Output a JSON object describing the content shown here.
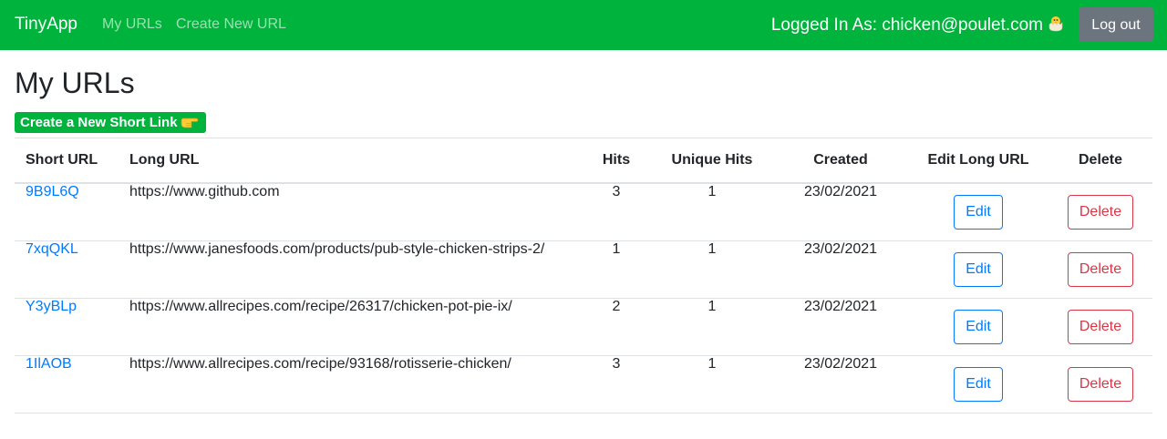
{
  "navbar": {
    "brand": "TinyApp",
    "links": [
      "My URLs",
      "Create New URL"
    ],
    "logged_in_text": "Logged In As: chicken@poulet.com",
    "logged_in_icon": "hatching-chick-icon",
    "logout_label": "Log out",
    "background_color": "#00b33c"
  },
  "page": {
    "title": "My URLs",
    "create_button_label": "Create a New Short Link",
    "create_button_icon": "pointing-hand-icon"
  },
  "table": {
    "headers": [
      "Short URL",
      "Long URL",
      "Hits",
      "Unique Hits",
      "Created",
      "Edit Long URL",
      "Delete"
    ],
    "rows": [
      {
        "short": "9B9L6Q",
        "long": "https://www.github.com",
        "hits": "3",
        "unique": "1",
        "created": "23/02/2021",
        "edit": "Edit",
        "delete": "Delete"
      },
      {
        "short": "7xqQKL",
        "long": "https://www.janesfoods.com/products/pub-style-chicken-strips-2/",
        "hits": "1",
        "unique": "1",
        "created": "23/02/2021",
        "edit": "Edit",
        "delete": "Delete"
      },
      {
        "short": "Y3yBLp",
        "long": "https://www.allrecipes.com/recipe/26317/chicken-pot-pie-ix/",
        "hits": "2",
        "unique": "1",
        "created": "23/02/2021",
        "edit": "Edit",
        "delete": "Delete"
      },
      {
        "short": "1IlAOB",
        "long": "https://www.allrecipes.com/recipe/93168/rotisserie-chicken/",
        "hits": "3",
        "unique": "1",
        "created": "23/02/2021",
        "edit": "Edit",
        "delete": "Delete"
      }
    ]
  },
  "colors": {
    "link": "#007bff",
    "danger": "#dc3545",
    "secondary": "#6c757d"
  }
}
